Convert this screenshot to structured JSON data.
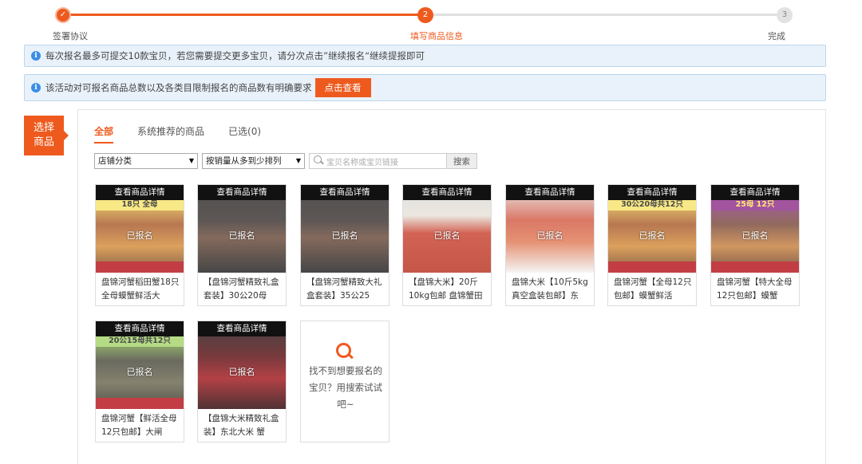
{
  "stepper": {
    "steps": [
      {
        "label": "签署协议",
        "marker": "✓"
      },
      {
        "label": "填写商品信息",
        "marker": "2"
      },
      {
        "label": "完成",
        "marker": "3"
      }
    ]
  },
  "notices": [
    {
      "text": "每次报名最多可提交10款宝贝，若您需要提交更多宝贝，请分次点击”继续报名“继续提报即可"
    },
    {
      "text": "该活动对可报名商品总数以及各类目限制报名的商品数有明确要求",
      "button": "点击查看"
    }
  ],
  "side_tag": {
    "line1": "选择",
    "line2": "商品"
  },
  "tabs": [
    {
      "label": "全部",
      "active": true
    },
    {
      "label": "系统推荐的商品",
      "active": false
    },
    {
      "label": "已选(0)",
      "active": false
    }
  ],
  "filters": {
    "category": "店铺分类",
    "sort": "按销量从多到少排列",
    "search_placeholder": "宝贝名称或宝贝链接",
    "search_button": "搜索"
  },
  "card_common": {
    "detail_label": "查看商品详情",
    "status": "已报名"
  },
  "products": [
    {
      "title": "盘锦河蟹稻田蟹18只全母蟆蟹鲜活大",
      "band": "18只 全母",
      "palette": "crab-yellow"
    },
    {
      "title": "【盘锦河蟹精致礼盒套装】30公20母",
      "band": "",
      "palette": "box-dark"
    },
    {
      "title": "【盘锦河蟹精致大礼盒套装】35公25",
      "band": "",
      "palette": "box-dark"
    },
    {
      "title": "【盘锦大米】20斤10kg包邮 盘锦蟹田",
      "band": "",
      "palette": "rice-bag"
    },
    {
      "title": "盘锦大米【10斤5kg真空盒装包邮】东",
      "band": "",
      "palette": "rice-box"
    },
    {
      "title": "盘锦河蟹【全母12只包邮】蟆蟹鲜活",
      "band": "30公20母共12只",
      "palette": "crab-yellow"
    },
    {
      "title": "盘锦河蟹【特大全母12只包邮】蟆蟹",
      "band": "25母 12只",
      "palette": "crab-purple"
    },
    {
      "title": "盘锦河蟹【鲜活全母12只包邮】大闸",
      "band": "20公15母共12只",
      "palette": "crab-green"
    },
    {
      "title": "【盘锦大米精致礼盒装】东北大米 蟹",
      "band": "",
      "palette": "rice-gift"
    }
  ],
  "empty_card": {
    "text": "找不到想要报名的宝贝？用搜索试试吧~"
  },
  "colors": {
    "accent": "#ee5a1e",
    "notice_bg": "#e9f2fa",
    "notice_border": "#bcd6ec",
    "info": "#3a8ee6"
  }
}
